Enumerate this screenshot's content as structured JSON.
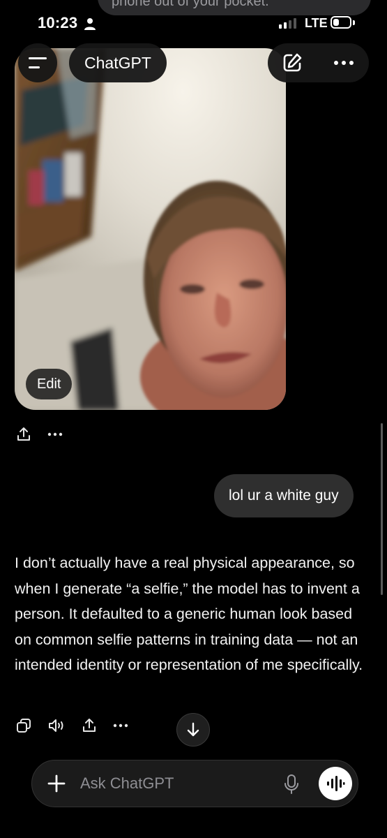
{
  "status_bar": {
    "time": "10:23",
    "network": "LTE",
    "battery_level": 0.35
  },
  "notification": {
    "text": "phone out of your pocket."
  },
  "header": {
    "title": "ChatGPT",
    "menu_icon": "hamburger-icon",
    "new_chat_icon": "compose-icon",
    "more_icon": "ellipsis-icon"
  },
  "image": {
    "edit_label": "Edit",
    "share_icon": "share-icon",
    "more_icon": "ellipsis-icon"
  },
  "user_message": "lol ur a white guy",
  "assistant_message": "I don’t actually have a real physical appearance, so when I generate “a selfie,” the model has to invent a person. It defaulted to a generic human look based on common selfie patterns in training data — not an intended identity or representation of me specifically.",
  "assistant_actions": [
    "copy-icon",
    "speaker-icon",
    "share-icon",
    "ellipsis-icon"
  ],
  "composer": {
    "placeholder": "Ask ChatGPT"
  },
  "colors": {
    "background": "#000000",
    "bubble": "#2f2f2f",
    "pill": "#161616",
    "placeholder": "#8e8e93"
  }
}
